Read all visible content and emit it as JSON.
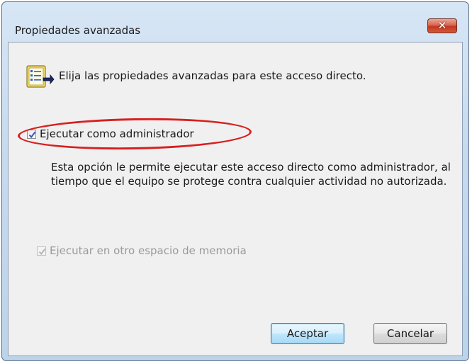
{
  "window": {
    "title": "Propiedades avanzadas",
    "close_symbol": "✕"
  },
  "header": {
    "icon": "shortcut-properties-icon",
    "text": "Elija las propiedades avanzadas para este acceso directo."
  },
  "options": {
    "run_as_admin": {
      "label": "Ejecutar como administrador",
      "checked": true,
      "enabled": true,
      "description": "Esta opción le permite ejecutar este acceso directo como administrador, al tiempo que el equipo se protege contra cualquier actividad no autorizada."
    },
    "separate_memory": {
      "label": "Ejecutar en otro espacio de memoria",
      "checked": true,
      "enabled": false
    }
  },
  "annotation": {
    "color": "#d81f1f"
  },
  "buttons": {
    "ok": "Aceptar",
    "cancel": "Cancelar"
  }
}
